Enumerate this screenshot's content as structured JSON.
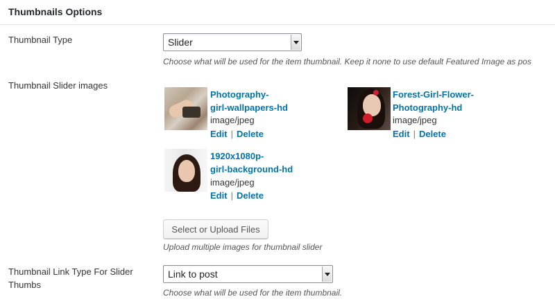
{
  "section": {
    "title": "Thumbnails Options"
  },
  "fields": {
    "thumbnail_type": {
      "label": "Thumbnail Type",
      "selected": "Slider",
      "description": "Choose what will be used for the item thumbnail. Keep it none to use default Featured Image as pos"
    },
    "slider_images": {
      "label": "Thumbnail Slider images",
      "items": [
        {
          "title_line1": "Photography-",
          "title_line2": "girl-wallpapers-hd",
          "mime": "image/jpeg",
          "edit": "Edit",
          "sep": "|",
          "delete": "Delete"
        },
        {
          "title_line1": "Forest-Girl-Flower-",
          "title_line2": "Photography-hd",
          "mime": "image/jpeg",
          "edit": "Edit",
          "sep": "|",
          "delete": "Delete"
        },
        {
          "title_line1": "1920x1080p-",
          "title_line2": "girl-background-hd",
          "mime": "image/jpeg",
          "edit": "Edit",
          "sep": "|",
          "delete": "Delete"
        }
      ],
      "button": "Select or Upload Files",
      "description": "Upload multiple images for thumbnail slider"
    },
    "link_type": {
      "label_line1": "Thumbnail Link Type For Slider",
      "label_line2": "Thumbs",
      "selected": "Link to post",
      "description": "Choose what will be used for the item thumbnail."
    }
  },
  "icons": {
    "dropdown": "chevron-down-icon"
  }
}
